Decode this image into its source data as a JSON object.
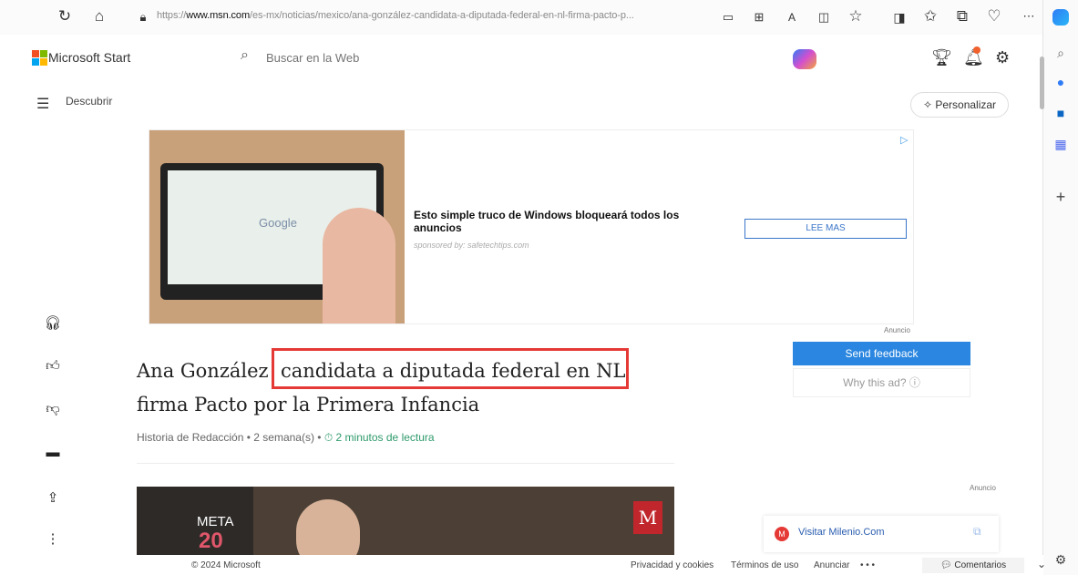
{
  "browser": {
    "url_prefix": "https://",
    "url_domain": "www.msn.com",
    "url_path": "/es-mx/noticias/mexico/ana-gonzález-candidata-a-diputada-federal-en-nl-firma-pacto-p...",
    "icons": [
      "reload-icon",
      "home-icon",
      "lock-icon",
      "reader-icon",
      "apps-icon",
      "read-aloud-icon",
      "split-icon",
      "favorite-icon",
      "sidebar-icon",
      "favorites-icon",
      "collections-icon",
      "health-icon",
      "more-icon",
      "copilot-icon"
    ]
  },
  "msn": {
    "brand": "Microsoft Start",
    "search_placeholder": "Buscar en la Web",
    "discover": "Descubrir",
    "personalize": "Personalizar"
  },
  "ad": {
    "image_text": "Google",
    "title": "Esto simple truco de Windows bloqueará todos los anuncios",
    "sponsor": "sponsored by: safetechtips.com",
    "button": "LEE MAS",
    "label": "Anuncio",
    "feedback": "Send feedback",
    "why": "Why this ad? ⓘ"
  },
  "article": {
    "title_part1": "Ana González",
    "title_highlight": "candidata a diputada federal en NL",
    "title_part2": "firma Pacto por la Primera Infancia",
    "meta": "Historia de Redacción • 2 semana(s) • ",
    "read_time": "⏱ 2 minutos de lectura",
    "photo_meta": "META",
    "photo_number": "20",
    "photo_logo": "M",
    "ad_label_2": "Anuncio"
  },
  "visit": {
    "icon": "M",
    "label": "Visitar Milenio.Com"
  },
  "footer": {
    "copyright": "© 2024 Microsoft",
    "privacy": "Privacidad y cookies",
    "terms": "Términos de uso",
    "advertise": "Anunciar",
    "more": "• • •",
    "comments": "Comentarios"
  },
  "colors": {
    "accent": "#2a86e0",
    "highlight": "#e53935"
  }
}
